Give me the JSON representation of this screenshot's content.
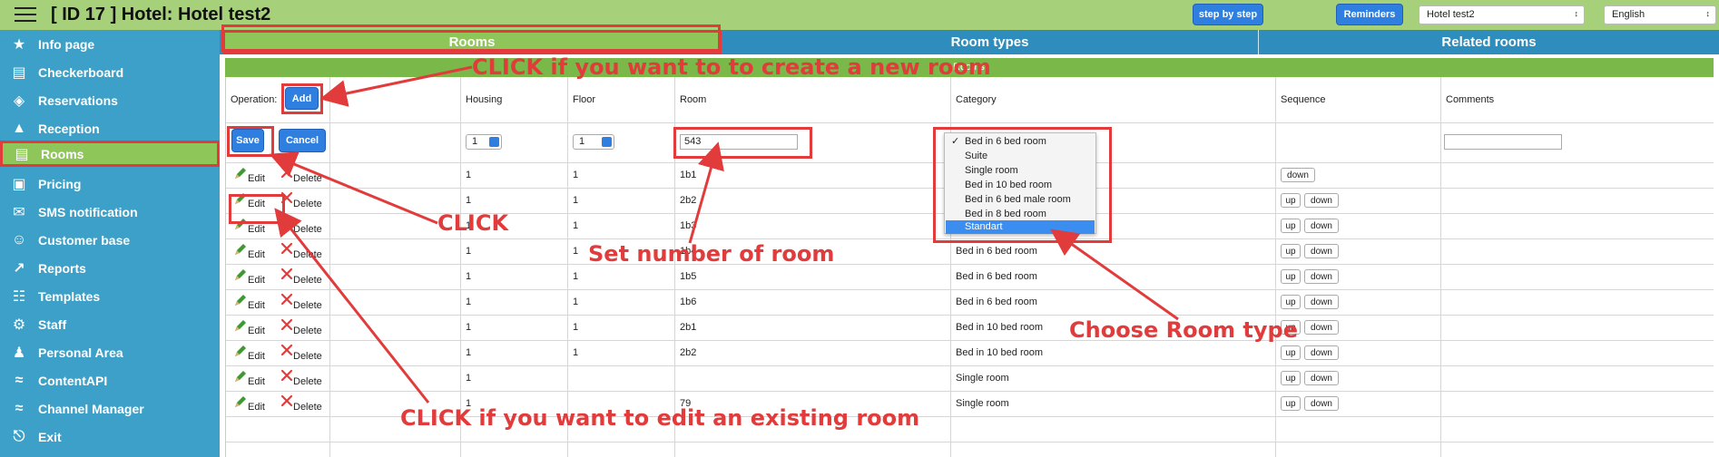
{
  "header": {
    "title": "[ ID 17 ] Hotel: Hotel test2",
    "step_btn": "step by step",
    "reminders_btn": "Reminders",
    "hotel_select": "Hotel test2",
    "language_select": "English"
  },
  "sidebar": {
    "items": [
      {
        "label": "Info page",
        "icon": "star-icon"
      },
      {
        "label": "Checkerboard",
        "icon": "grid-icon"
      },
      {
        "label": "Reservations",
        "icon": "tag-icon"
      },
      {
        "label": "Reception",
        "icon": "reception-icon"
      },
      {
        "label": "Rooms",
        "icon": "bed-icon",
        "active": true
      },
      {
        "label": "Pricing",
        "icon": "wallet-icon"
      },
      {
        "label": "SMS notification",
        "icon": "sms-icon"
      },
      {
        "label": "Customer base",
        "icon": "customer-icon"
      },
      {
        "label": "Reports",
        "icon": "chart-icon"
      },
      {
        "label": "Templates",
        "icon": "document-icon"
      },
      {
        "label": "Staff",
        "icon": "gear-icon"
      },
      {
        "label": "Personal Area",
        "icon": "user-icon"
      },
      {
        "label": "ContentAPI",
        "icon": "api-icon"
      },
      {
        "label": "Channel Manager",
        "icon": "channel-icon"
      },
      {
        "label": "Exit",
        "icon": "exit-icon"
      }
    ]
  },
  "tabs": [
    {
      "label": "Rooms",
      "active": true
    },
    {
      "label": "Room types"
    },
    {
      "label": "Related rooms"
    }
  ],
  "section_title": "Rooms",
  "table": {
    "headers": [
      "Operation:",
      "Housing",
      "Floor",
      "Room",
      "Category",
      "Sequence",
      "Comments"
    ],
    "add_btn": "Add",
    "save_btn": "Save",
    "cancel_btn": "Cancel",
    "edit_row": {
      "housing": "1",
      "floor": "1",
      "room": "543"
    },
    "edit_label": "Edit",
    "delete_label": "Delete",
    "up_label": "up",
    "down_label": "down",
    "rows": [
      {
        "housing": "1",
        "floor": "1",
        "room": "1b1",
        "category": ""
      },
      {
        "housing": "1",
        "floor": "1",
        "room": "2b2",
        "category": ""
      },
      {
        "housing": "1",
        "floor": "1",
        "room": "1b3",
        "category": "Bed in 6 bed room"
      },
      {
        "housing": "1",
        "floor": "1",
        "room": "1b4",
        "category": "Bed in 6 bed room"
      },
      {
        "housing": "1",
        "floor": "1",
        "room": "1b5",
        "category": "Bed in 6 bed room"
      },
      {
        "housing": "1",
        "floor": "1",
        "room": "1b6",
        "category": "Bed in 6 bed room"
      },
      {
        "housing": "1",
        "floor": "1",
        "room": "2b1",
        "category": "Bed in 10 bed room"
      },
      {
        "housing": "1",
        "floor": "1",
        "room": "2b2",
        "category": "Bed in 10 bed room"
      },
      {
        "housing": "1",
        "floor": "",
        "room": "",
        "category": "Single room"
      },
      {
        "housing": "1",
        "floor": "",
        "room": "79",
        "category": "Single room"
      }
    ]
  },
  "category_dropdown": {
    "options": [
      "Bed in 6 bed room",
      "Suite",
      "Single room",
      "Bed in 10 bed room",
      "Bed in 6 bed male room",
      "Bed in 8 bed room",
      "Standart"
    ],
    "checked": "Bed in 6 bed room",
    "highlighted": "Standart"
  },
  "annotations": {
    "create": "CLICK if you want to to create a new room",
    "click": "CLICK",
    "set_number": "Set number of room",
    "choose_type": "Choose Room type",
    "edit_existing": "CLICK if you want to edit an existing room"
  },
  "colors": {
    "topbar": "#a6d07a",
    "sidebar": "#3da0c8",
    "tabbar": "#2e8dbd",
    "active_green": "#8fc65a",
    "button_blue": "#2f7fe0",
    "annotation_red": "#e23b3b"
  }
}
